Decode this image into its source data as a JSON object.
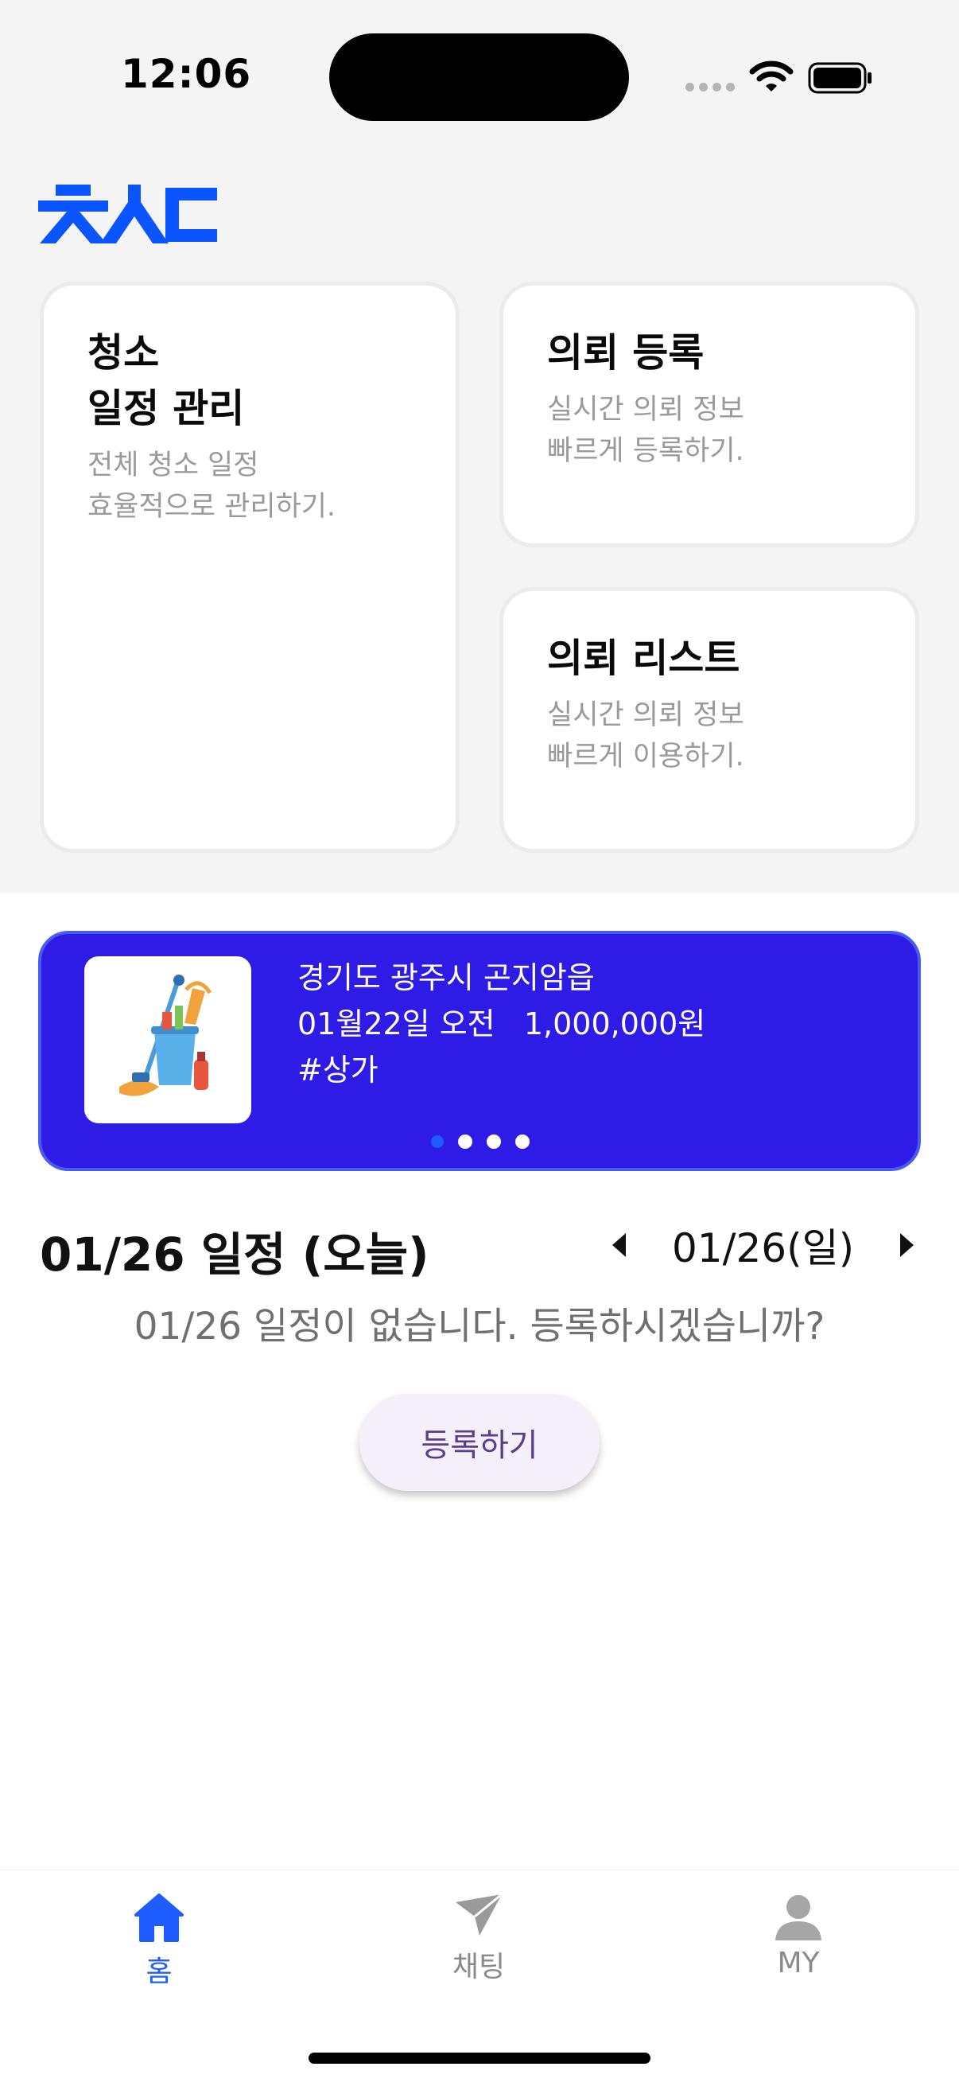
{
  "status_bar": {
    "time": "12:06"
  },
  "brand": {
    "color": "#0a55ff"
  },
  "menu_cards": [
    {
      "title": "청소\n일정 관리",
      "description": "전체 청소 일정\n효율적으로 관리하기."
    },
    {
      "title": "의뢰 등록",
      "description": "실시간 의뢰 정보\n빠르게 등록하기."
    },
    {
      "title": "의뢰 리스트",
      "description": "실시간 의뢰 정보\n빠르게 이용하기."
    }
  ],
  "banner": {
    "location": "경기도 광주시 곤지암읍",
    "schedule_price": "01월22일 오전   1,000,000원",
    "tag": "#상가",
    "background_color": "#2e1be6",
    "active_page": 1,
    "page_count": 4
  },
  "schedule": {
    "title": "01/26 일정 (오늘)",
    "date_label": "01/26(일)",
    "empty_message": "01/26 일정이 없습니다. 등록하시겠습니까?",
    "register_label": "등록하기"
  },
  "bottom_nav": {
    "items": [
      {
        "label": "홈",
        "icon": "home-icon",
        "active": true
      },
      {
        "label": "채팅",
        "icon": "send-icon",
        "active": false
      },
      {
        "label": "MY",
        "icon": "person-icon",
        "active": false
      }
    ],
    "active_color": "#1e5dff",
    "inactive_color": "#8a8a8a"
  }
}
